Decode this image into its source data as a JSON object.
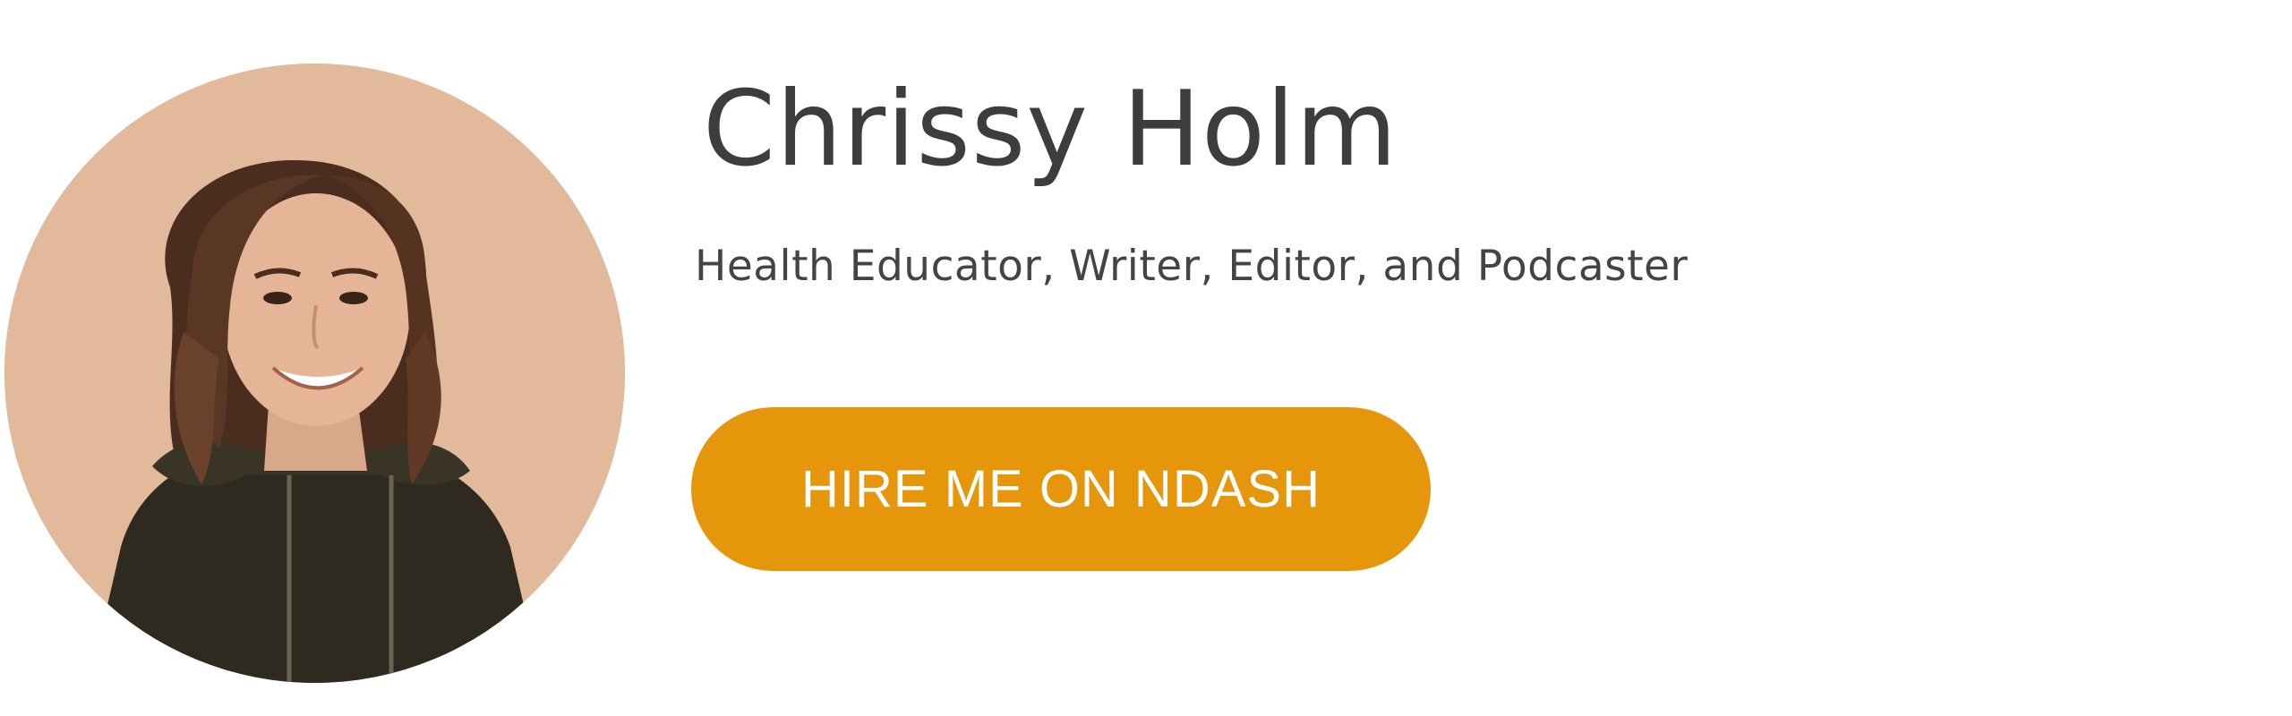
{
  "profile": {
    "name": "Chrissy Holm",
    "tagline": "Health Educator, Writer, Editor, and Podcaster",
    "hire_button_label": "HIRE ME ON NDASH",
    "accent_color": "#e5960a",
    "avatar_description_icon": "profile-photo"
  }
}
